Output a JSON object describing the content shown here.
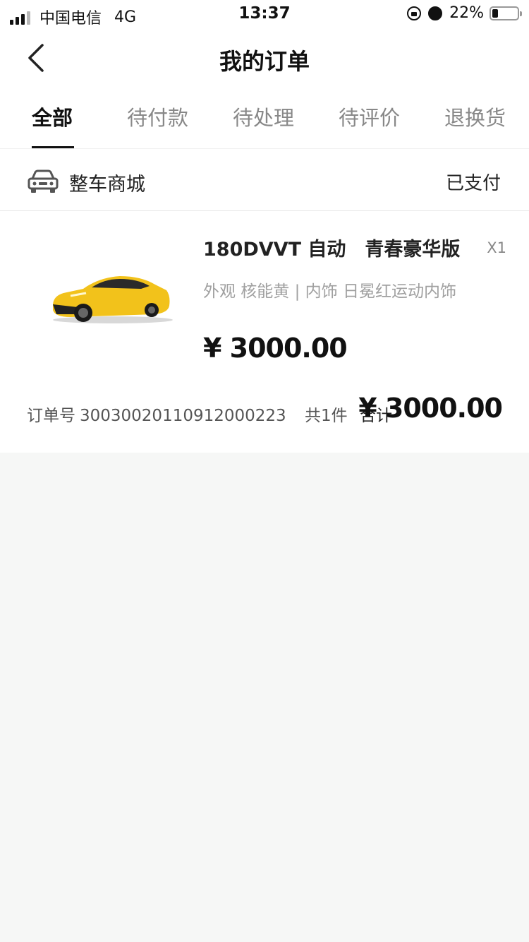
{
  "status_bar": {
    "carrier": "中国电信",
    "network": "4G",
    "time": "13:37",
    "battery_percent": "22%"
  },
  "navbar": {
    "title": "我的订单"
  },
  "tabs": [
    {
      "label": "全部",
      "active": true
    },
    {
      "label": "待付款",
      "active": false
    },
    {
      "label": "待处理",
      "active": false
    },
    {
      "label": "待评价",
      "active": false
    },
    {
      "label": "退换货",
      "active": false
    }
  ],
  "order": {
    "shop_name": "整车商城",
    "status": "已支付",
    "product_title": "180DVVT 自动　青春豪华版",
    "quantity": "X1",
    "spec": "外观 核能黄 | 内饰 日冕红运动内饰",
    "price": "¥ 3000.00",
    "order_no_label": "订单号",
    "order_no": "30030020110912000223",
    "item_count": "共1件",
    "total_label": "合计",
    "total_price": "¥ 3000.00",
    "car_color": "#f2c21b"
  }
}
